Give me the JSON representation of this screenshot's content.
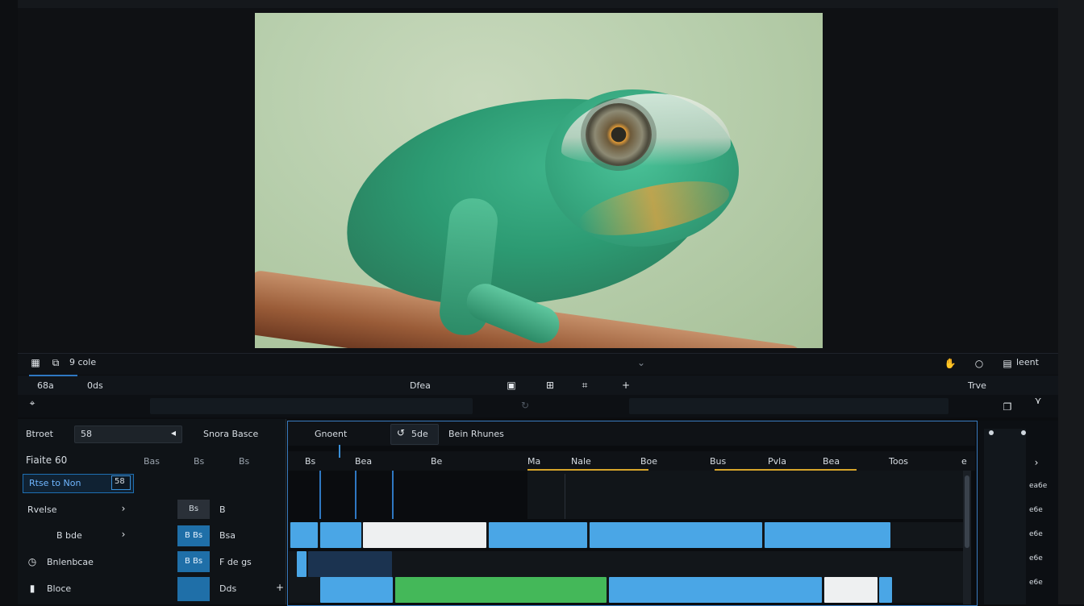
{
  "toolbar_top": {
    "left_label": "9 cole",
    "right_label": "leent"
  },
  "toolbar_second": {
    "left_a": "68a",
    "left_b": "0ds",
    "center": "Dfea",
    "right": "Trve"
  },
  "left_panel": {
    "row1_label": "Btroet",
    "row1_value": "58",
    "row1_btn": "Snora Basce",
    "row2_title": "Fiaite 60",
    "row2_cols": [
      "Bas",
      "Bs",
      "Bs"
    ],
    "row3_label": "Rtse  to  Non",
    "row3_value": "58",
    "row4_label": "Rvelse",
    "row4_chip": "Bs",
    "row4_side": "B",
    "row5_label": "B  bde",
    "row5_chip": "B  Bs",
    "row5_side": "Bsa",
    "row6_label": "Bnlenbcae",
    "row6_chip": "B  Bs",
    "row6_side": "F  de  gs",
    "row7_label": "Bloce",
    "row7_chip": "",
    "row7_side": "Dds"
  },
  "timeline": {
    "tab_active": "Gnoent",
    "tab_icon_text": "5de",
    "tab_title": "Bein  Rhunes",
    "ruler": [
      "Bs",
      "Bea",
      "Be",
      "Ma",
      "Nale",
      "Boe",
      "Bus",
      "Pvla",
      "Bea",
      "Toos"
    ],
    "ruler_end": "e"
  },
  "right_panel": {
    "labels": [
      "ea6e",
      "e6e",
      "e6e",
      "e6e",
      "e6e"
    ]
  },
  "colors": {
    "accent": "#2f78c2",
    "clip_blue": "#4aa6e6",
    "clip_green": "#44b859",
    "clip_white": "#eef0f1"
  }
}
